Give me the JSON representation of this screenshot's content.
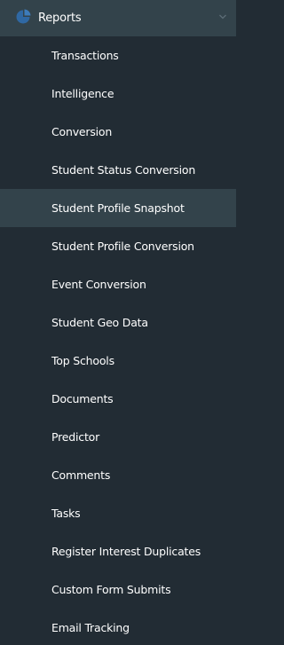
{
  "section": {
    "label": "Reports",
    "icon": "reports-icon",
    "expanded": true
  },
  "menu": {
    "items": [
      {
        "label": "Transactions",
        "active": false
      },
      {
        "label": "Intelligence",
        "active": false
      },
      {
        "label": "Conversion",
        "active": false
      },
      {
        "label": "Student Status Conversion",
        "active": false
      },
      {
        "label": "Student Profile Snapshot",
        "active": true
      },
      {
        "label": "Student Profile Conversion",
        "active": false
      },
      {
        "label": "Event Conversion",
        "active": false
      },
      {
        "label": "Student Geo Data",
        "active": false
      },
      {
        "label": "Top Schools",
        "active": false
      },
      {
        "label": "Documents",
        "active": false
      },
      {
        "label": "Predictor",
        "active": false
      },
      {
        "label": "Comments",
        "active": false
      },
      {
        "label": "Tasks",
        "active": false
      },
      {
        "label": "Register Interest Duplicates",
        "active": false
      },
      {
        "label": "Custom Form Submits",
        "active": false
      },
      {
        "label": "Email Tracking",
        "active": false
      }
    ]
  },
  "colors": {
    "background": "#222c34",
    "active_background": "#33434b",
    "text": "#ffffff",
    "icon": "#2f6fb3",
    "chevron": "#5d6d76"
  }
}
